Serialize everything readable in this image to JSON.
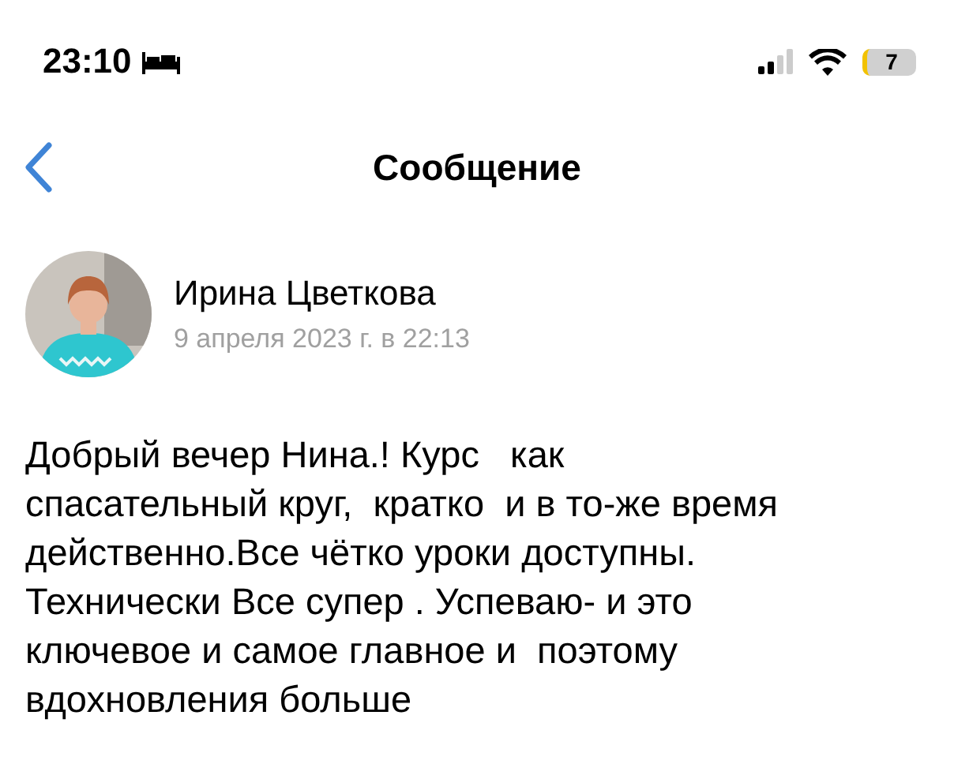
{
  "status_bar": {
    "time": "23:10",
    "battery": "7"
  },
  "nav": {
    "title": "Сообщение"
  },
  "message": {
    "author": "Ирина Цветкова",
    "date": "9 апреля 2023 г. в 22:13",
    "text": "Добрый вечер Нина.! Курс   как\nспасательный круг,  кратко  и в то-же время\nдейственно.Все чётко уроки доступны.\nТехнически Все супер . Успеваю- и это\nключевое и самое главное и  поэтому\nвдохновления больше"
  }
}
